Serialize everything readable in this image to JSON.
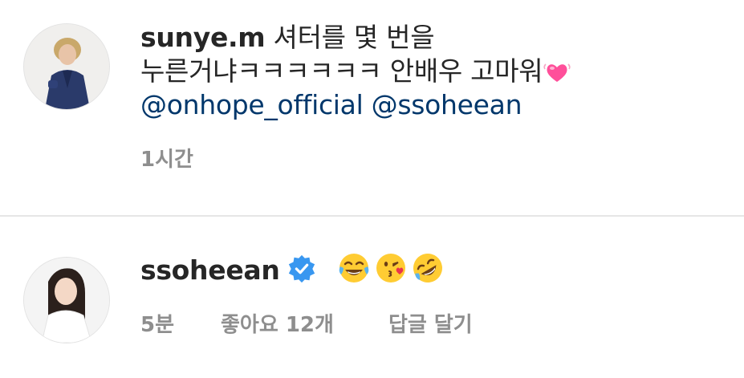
{
  "comments": [
    {
      "username": "sunye.m",
      "text_line1": "셔터를 몇 번을",
      "text_line2": "누른거냐ㅋㅋㅋㅋㅋㅋ 안배우 고마워",
      "emoji_after_text": "growing-heart",
      "mentions": [
        "@onhope_official",
        "@ssoheean"
      ],
      "time": "1시간"
    },
    {
      "username": "ssoheean",
      "verified": true,
      "emojis": [
        "face-with-tears-of-joy",
        "face-blowing-a-kiss",
        "rolling-on-the-floor-laughing"
      ],
      "time": "5분",
      "likes": "좋아요 12개",
      "reply": "답글 달기"
    }
  ],
  "colors": {
    "text": "#262626",
    "secondary": "#8e8e8e",
    "mention": "#00376b",
    "verified": "#3897f0",
    "divider": "#e6e6e6"
  }
}
